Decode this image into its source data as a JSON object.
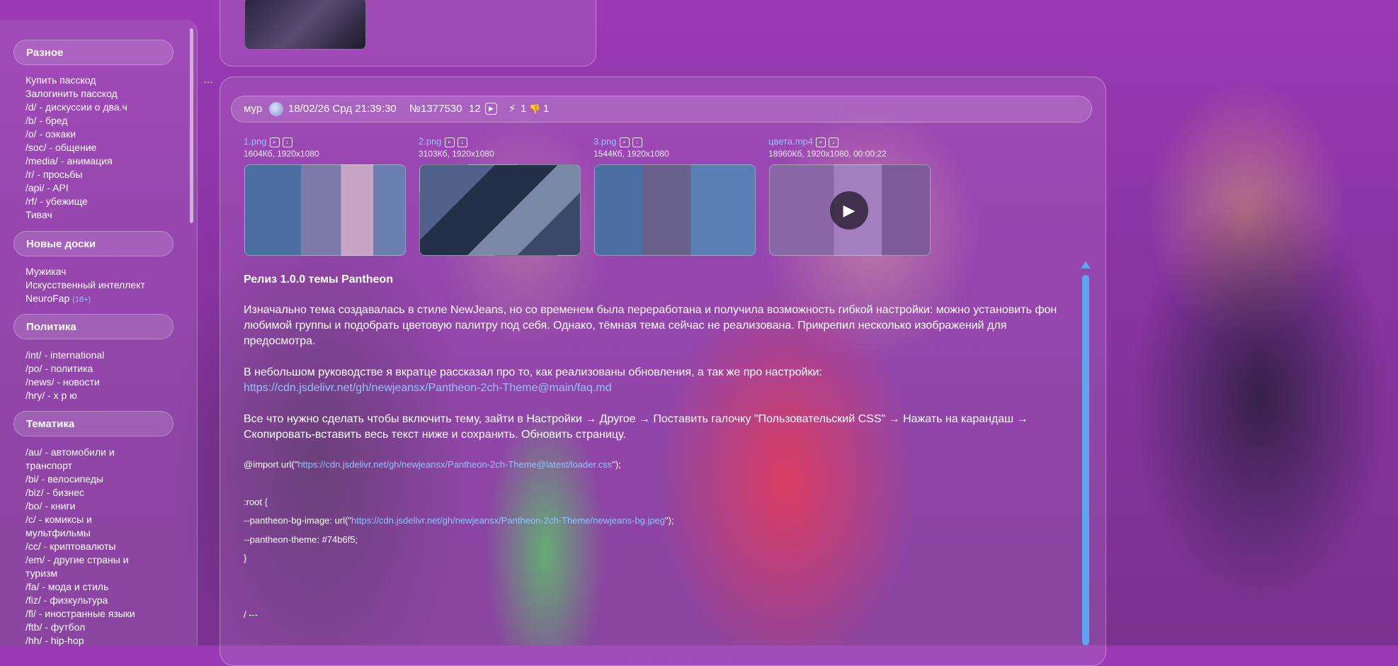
{
  "sidebar": {
    "more_icon": "…",
    "sections": [
      {
        "title": "Разное",
        "items": [
          "Купить пасскод",
          "Залогинить пасскод",
          "/d/ - дискуссии о два.ч",
          "/b/ - бред",
          "/o/ - оэкаки",
          "/soc/ - общение",
          "/media/ - анимация",
          "/r/ - просьбы",
          "/api/ - API",
          "/rf/ - убежище",
          "Тивач"
        ]
      },
      {
        "title": "Новые доски",
        "items": [
          "Мужикач",
          "Искусственный интеллект",
          "NeuroFap"
        ],
        "badge": "(18+)"
      },
      {
        "title": "Политика",
        "items": [
          "/int/ - international",
          "/po/ - политика",
          "/news/ - новости",
          "/hry/ - х р ю"
        ]
      },
      {
        "title": "Тематика",
        "items": [
          "/au/ - автомобили и",
          "транспорт",
          "/bi/ - велосипеды",
          "/biz/ - бизнес",
          "/bo/ - книги",
          "/c/ - комиксы и",
          "мультфильмы",
          "/cc/ - криптовалюты",
          "/em/ - другие страны и",
          "туризм",
          "/fa/ - мода и стиль",
          "/fiz/ - физкультура",
          "/fl/ - иностранные языки",
          "/ftb/ - футбол",
          "/hh/ - hip-hop"
        ]
      }
    ]
  },
  "post": {
    "author": "мур",
    "datetime": "18/02/26 Срд 21:39:30",
    "number": "№1377530",
    "replies": "12",
    "play_icon": "▶",
    "likes": "1",
    "dislikes": "1",
    "like_icon": "⚡",
    "dislike_icon": "👎",
    "files": [
      {
        "name": "1.png",
        "meta": "1604Кб, 1920x1080"
      },
      {
        "name": "2.png",
        "meta": "3103Кб, 1920x1080"
      },
      {
        "name": "3.png",
        "meta": "1544Кб, 1920x1080"
      },
      {
        "name": "цвета.mp4",
        "meta": "18960Кб, 1920x1080, 00:00:22"
      }
    ],
    "video_play_icon": "▶",
    "title": "Релиз 1.0.0 темы Pantheon",
    "para1": "Изначально тема создавалась в стиле NewJeans, но со временем была переработана и получила возможность гибкой настройки: можно установить фон любимой группы и подобрать цветовую палитру под себя. Однако, тёмная тема сейчас не реализована. Прикрепил несколько изображений для предосмотра.",
    "para2": "В небольшом руководстве я вкратце рассказал про то, как реализованы обновления, а так же про настройки:",
    "faq_link": "https://cdn.jsdelivr.net/gh/newjeansx/Pantheon-2ch-Theme@main/faq.md",
    "para3": "Все что нужно сделать чтобы включить тему, зайти в Настройки → Другое → Поставить галочку \"Пользовательский CSS\" → Нажать на карандаш → Скопировать-вставить весь текст ниже и сохранить. Обновить страницу.",
    "code": {
      "import_prefix": "@import url(\"",
      "import_link": "https://cdn.jsdelivr.net/gh/newjeansx/Pantheon-2ch-Theme@latest/loader.css",
      "import_suffix": "\");",
      "root_open": ":root {",
      "bg_prefix": "--pantheon-bg-image: url(\"",
      "bg_link": "https://cdn.jsdelivr.net/gh/newjeansx/Pantheon-2ch-Theme/newjeans-bg.jpeg",
      "bg_suffix": "\");",
      "theme_line": "--pantheon-theme: #74b6f5;",
      "root_close": "}",
      "separator": "/ ---"
    }
  },
  "colors": {
    "accent_link": "#8fc4ff",
    "scrollbar": "#5aa7f0"
  }
}
